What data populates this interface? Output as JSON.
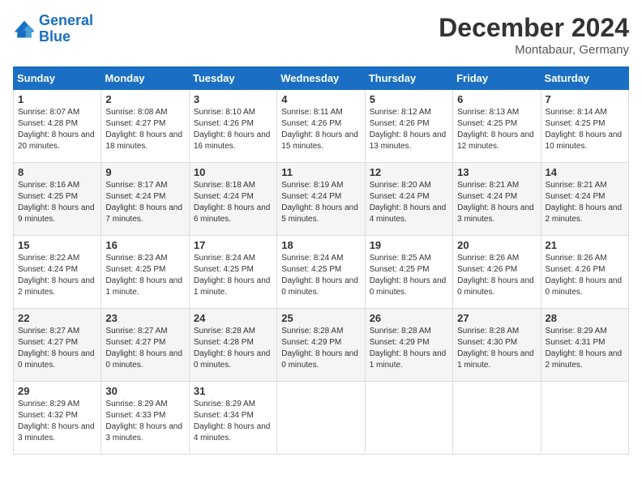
{
  "header": {
    "logo_line1": "General",
    "logo_line2": "Blue",
    "month": "December 2024",
    "location": "Montabaur, Germany"
  },
  "weekdays": [
    "Sunday",
    "Monday",
    "Tuesday",
    "Wednesday",
    "Thursday",
    "Friday",
    "Saturday"
  ],
  "weeks": [
    [
      {
        "day": "1",
        "sunrise": "Sunrise: 8:07 AM",
        "sunset": "Sunset: 4:28 PM",
        "daylight": "Daylight: 8 hours and 20 minutes."
      },
      {
        "day": "2",
        "sunrise": "Sunrise: 8:08 AM",
        "sunset": "Sunset: 4:27 PM",
        "daylight": "Daylight: 8 hours and 18 minutes."
      },
      {
        "day": "3",
        "sunrise": "Sunrise: 8:10 AM",
        "sunset": "Sunset: 4:26 PM",
        "daylight": "Daylight: 8 hours and 16 minutes."
      },
      {
        "day": "4",
        "sunrise": "Sunrise: 8:11 AM",
        "sunset": "Sunset: 4:26 PM",
        "daylight": "Daylight: 8 hours and 15 minutes."
      },
      {
        "day": "5",
        "sunrise": "Sunrise: 8:12 AM",
        "sunset": "Sunset: 4:26 PM",
        "daylight": "Daylight: 8 hours and 13 minutes."
      },
      {
        "day": "6",
        "sunrise": "Sunrise: 8:13 AM",
        "sunset": "Sunset: 4:25 PM",
        "daylight": "Daylight: 8 hours and 12 minutes."
      },
      {
        "day": "7",
        "sunrise": "Sunrise: 8:14 AM",
        "sunset": "Sunset: 4:25 PM",
        "daylight": "Daylight: 8 hours and 10 minutes."
      }
    ],
    [
      {
        "day": "8",
        "sunrise": "Sunrise: 8:16 AM",
        "sunset": "Sunset: 4:25 PM",
        "daylight": "Daylight: 8 hours and 9 minutes."
      },
      {
        "day": "9",
        "sunrise": "Sunrise: 8:17 AM",
        "sunset": "Sunset: 4:24 PM",
        "daylight": "Daylight: 8 hours and 7 minutes."
      },
      {
        "day": "10",
        "sunrise": "Sunrise: 8:18 AM",
        "sunset": "Sunset: 4:24 PM",
        "daylight": "Daylight: 8 hours and 6 minutes."
      },
      {
        "day": "11",
        "sunrise": "Sunrise: 8:19 AM",
        "sunset": "Sunset: 4:24 PM",
        "daylight": "Daylight: 8 hours and 5 minutes."
      },
      {
        "day": "12",
        "sunrise": "Sunrise: 8:20 AM",
        "sunset": "Sunset: 4:24 PM",
        "daylight": "Daylight: 8 hours and 4 minutes."
      },
      {
        "day": "13",
        "sunrise": "Sunrise: 8:21 AM",
        "sunset": "Sunset: 4:24 PM",
        "daylight": "Daylight: 8 hours and 3 minutes."
      },
      {
        "day": "14",
        "sunrise": "Sunrise: 8:21 AM",
        "sunset": "Sunset: 4:24 PM",
        "daylight": "Daylight: 8 hours and 2 minutes."
      }
    ],
    [
      {
        "day": "15",
        "sunrise": "Sunrise: 8:22 AM",
        "sunset": "Sunset: 4:24 PM",
        "daylight": "Daylight: 8 hours and 2 minutes."
      },
      {
        "day": "16",
        "sunrise": "Sunrise: 8:23 AM",
        "sunset": "Sunset: 4:25 PM",
        "daylight": "Daylight: 8 hours and 1 minute."
      },
      {
        "day": "17",
        "sunrise": "Sunrise: 8:24 AM",
        "sunset": "Sunset: 4:25 PM",
        "daylight": "Daylight: 8 hours and 1 minute."
      },
      {
        "day": "18",
        "sunrise": "Sunrise: 8:24 AM",
        "sunset": "Sunset: 4:25 PM",
        "daylight": "Daylight: 8 hours and 0 minutes."
      },
      {
        "day": "19",
        "sunrise": "Sunrise: 8:25 AM",
        "sunset": "Sunset: 4:25 PM",
        "daylight": "Daylight: 8 hours and 0 minutes."
      },
      {
        "day": "20",
        "sunrise": "Sunrise: 8:26 AM",
        "sunset": "Sunset: 4:26 PM",
        "daylight": "Daylight: 8 hours and 0 minutes."
      },
      {
        "day": "21",
        "sunrise": "Sunrise: 8:26 AM",
        "sunset": "Sunset: 4:26 PM",
        "daylight": "Daylight: 8 hours and 0 minutes."
      }
    ],
    [
      {
        "day": "22",
        "sunrise": "Sunrise: 8:27 AM",
        "sunset": "Sunset: 4:27 PM",
        "daylight": "Daylight: 8 hours and 0 minutes."
      },
      {
        "day": "23",
        "sunrise": "Sunrise: 8:27 AM",
        "sunset": "Sunset: 4:27 PM",
        "daylight": "Daylight: 8 hours and 0 minutes."
      },
      {
        "day": "24",
        "sunrise": "Sunrise: 8:28 AM",
        "sunset": "Sunset: 4:28 PM",
        "daylight": "Daylight: 8 hours and 0 minutes."
      },
      {
        "day": "25",
        "sunrise": "Sunrise: 8:28 AM",
        "sunset": "Sunset: 4:29 PM",
        "daylight": "Daylight: 8 hours and 0 minutes."
      },
      {
        "day": "26",
        "sunrise": "Sunrise: 8:28 AM",
        "sunset": "Sunset: 4:29 PM",
        "daylight": "Daylight: 8 hours and 1 minute."
      },
      {
        "day": "27",
        "sunrise": "Sunrise: 8:28 AM",
        "sunset": "Sunset: 4:30 PM",
        "daylight": "Daylight: 8 hours and 1 minute."
      },
      {
        "day": "28",
        "sunrise": "Sunrise: 8:29 AM",
        "sunset": "Sunset: 4:31 PM",
        "daylight": "Daylight: 8 hours and 2 minutes."
      }
    ],
    [
      {
        "day": "29",
        "sunrise": "Sunrise: 8:29 AM",
        "sunset": "Sunset: 4:32 PM",
        "daylight": "Daylight: 8 hours and 3 minutes."
      },
      {
        "day": "30",
        "sunrise": "Sunrise: 8:29 AM",
        "sunset": "Sunset: 4:33 PM",
        "daylight": "Daylight: 8 hours and 3 minutes."
      },
      {
        "day": "31",
        "sunrise": "Sunrise: 8:29 AM",
        "sunset": "Sunset: 4:34 PM",
        "daylight": "Daylight: 8 hours and 4 minutes."
      },
      null,
      null,
      null,
      null
    ]
  ]
}
